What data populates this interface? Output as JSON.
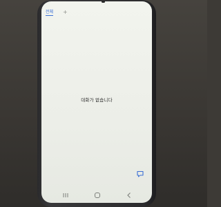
{
  "messages_app": {
    "tab_all_label": "전체",
    "add_label": "+",
    "empty_message": "대화가 없습니다"
  },
  "icons": {
    "compose": "compose-message-icon",
    "recent": "recent-apps-icon",
    "home": "home-icon",
    "back": "back-icon"
  },
  "colors": {
    "accent": "#3b6fd6",
    "screen_background": "#eceee8",
    "text": "#2b2b2b",
    "nav_icon": "#7c7f7a"
  }
}
